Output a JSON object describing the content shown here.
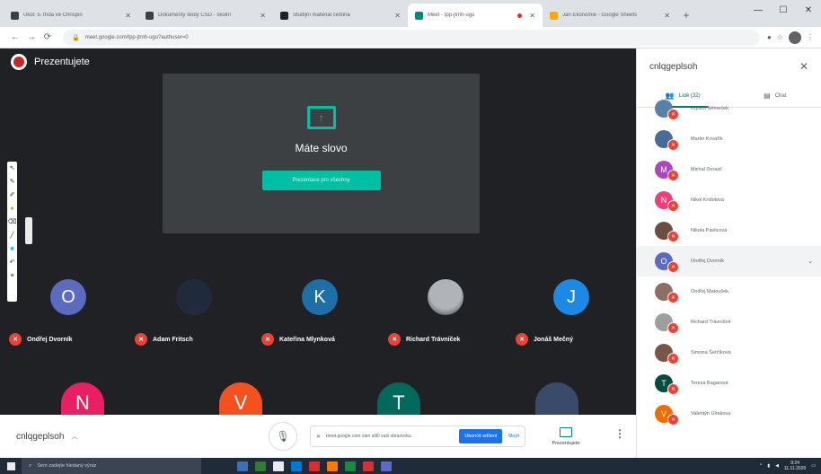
{
  "browser": {
    "tabs": [
      {
        "label": "Úkol: 5. třída ve Chrispin",
        "favicon_color": "#3c4043",
        "active": false
      },
      {
        "label": "Dokumenty školy CSD - školní",
        "favicon_color": "#3c4043",
        "active": false
      },
      {
        "label": "Studijní materiál čeština",
        "favicon_color": "#202124",
        "active": false
      },
      {
        "label": "Meet - tpp-jtmh-ugu",
        "favicon_color": "#00897b",
        "active": true,
        "recording": true
      },
      {
        "label": "Jan Ekonomie - Google Sheets",
        "favicon_color": "#f9ab00",
        "active": false
      }
    ],
    "new_tab": "+",
    "window_controls": {
      "minimize": "—",
      "maximize": "☐",
      "close": "✕"
    },
    "address": "meet.google.com/tpp-jtmh-ugu?authuser=0",
    "back": "←",
    "forward": "→",
    "reload": "⟳"
  },
  "stage": {
    "presenter_label": "Prezentujete",
    "share_card": {
      "title": "Máte slovo",
      "button": "Prezentace pro všechny",
      "icon": "present-screen-icon"
    },
    "tiles": [
      {
        "initial": "O",
        "name": "Ondřej Dvorník",
        "color": "#5c6bc0",
        "photo": false
      },
      {
        "initial": "",
        "name": "Adam Fritsch",
        "color": "#1f2a3a",
        "photo": true
      },
      {
        "initial": "K",
        "name": "Kateřina Mlynková",
        "color": "#1e6fa8",
        "photo": false
      },
      {
        "initial": "",
        "name": "Richard Trávníček",
        "color": "#b0b3b8",
        "photo": true
      },
      {
        "initial": "J",
        "name": "Jonáš Mečný",
        "color": "#1e88e5",
        "photo": false
      }
    ],
    "row2": [
      {
        "initial": "N",
        "color": "#e91e63"
      },
      {
        "initial": "V",
        "color": "#f4511e"
      },
      {
        "initial": "T",
        "color": "#00695c"
      },
      {
        "initial": "",
        "color": "#3a4a6b"
      }
    ]
  },
  "meetbar": {
    "meeting_code": "cnlqgeplsoh",
    "mic_icon": "mic-icon",
    "toast_text": "meet.google.com vám sdílí vaši obrazovku.",
    "toast_primary": "Ukončit sdílení",
    "toast_secondary": "Skrýt",
    "present_label": "Prezentujete",
    "more": "⋮"
  },
  "panel": {
    "title": "cnlqgeplsoh",
    "close": "✕",
    "tabs": [
      {
        "label": "Lidé (32)",
        "icon": "people-icon",
        "active": true
      },
      {
        "label": "Chat",
        "icon": "chat-icon",
        "active": false
      }
    ],
    "people": [
      {
        "initial": "",
        "name": "Krystof Němeček",
        "color": "#5a7fa8"
      },
      {
        "initial": "",
        "name": "Martin Kovařík",
        "color": "#4a6a9a"
      },
      {
        "initial": "M",
        "name": "Michal Dorazil",
        "color": "#ab47bc"
      },
      {
        "initial": "N",
        "name": "Nikol Krobitová",
        "color": "#ec407a"
      },
      {
        "initial": "",
        "name": "Nikola Pavlicová",
        "color": "#6d4c41"
      },
      {
        "initial": "O",
        "name": "Ondřej Dvorník",
        "color": "#5c6bc0",
        "highlighted": true
      },
      {
        "initial": "",
        "name": "Ondřej Matoušek",
        "color": "#8d6e63"
      },
      {
        "initial": "",
        "name": "Richard Trávníček",
        "color": "#9e9e9e"
      },
      {
        "initial": "",
        "name": "Simona Šerčíková",
        "color": "#795548"
      },
      {
        "initial": "T",
        "name": "Tereza Bagarová",
        "color": "#004d40"
      },
      {
        "initial": "V",
        "name": "Valentýn Ulrakova",
        "color": "#ef6c00"
      }
    ]
  },
  "taskbar": {
    "search_placeholder": "Sem zadejte hledaný výraz",
    "time": "9:24",
    "date": "11.11.2020",
    "apps": [
      "#3d6fb4",
      "#2e7d32",
      "#e8eaed",
      "#0078d4",
      "#d32f2f",
      "#f57c00",
      "#1b8a3e",
      "#d13438",
      "#5c6bc0"
    ]
  }
}
